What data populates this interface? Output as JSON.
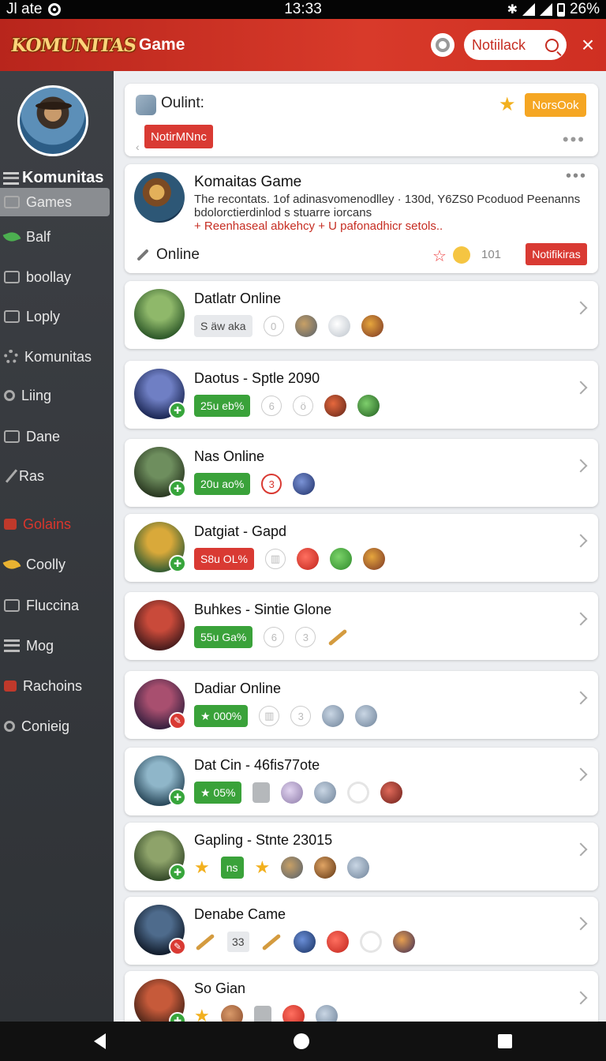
{
  "status": {
    "left": "Jl ate",
    "time": "13:33",
    "battery": "26%"
  },
  "header": {
    "logo": "KOMUNITAS",
    "game_label": "Game",
    "search_placeholder": "Notiilack",
    "close": "×"
  },
  "sidebar": {
    "title": "Komunitas",
    "items": [
      {
        "label": "Games",
        "icon": "games-icon",
        "active": true
      },
      {
        "label": "Balf",
        "icon": "leaf-icon"
      },
      {
        "label": "boollay",
        "icon": "box-icon"
      },
      {
        "label": "Loply",
        "icon": "grid-icon"
      },
      {
        "label": "Komunitas",
        "icon": "gear-icon"
      },
      {
        "label": "Liing",
        "icon": "search-icon"
      },
      {
        "label": "Dane",
        "icon": "box-icon"
      },
      {
        "label": "Ras",
        "icon": "wand-icon"
      },
      {
        "label": "Golains",
        "icon": "bag-icon",
        "red": true
      },
      {
        "label": "Coolly",
        "icon": "leaf-gold-icon"
      },
      {
        "label": "Fluccina",
        "icon": "grid-icon"
      },
      {
        "label": "Mog",
        "icon": "lines-icon"
      },
      {
        "label": "Rachoins",
        "icon": "bag-icon"
      },
      {
        "label": "Conieig",
        "icon": "user-icon"
      }
    ]
  },
  "top_card": {
    "title": "Oulint:",
    "badge": "NorsOok",
    "red_label": "NotirMNnc",
    "dot": "‹"
  },
  "featured": {
    "title": "Komaitas Game",
    "desc": "The recontats. 1of adinasvomenodlley · 130d, Y6ZS0 Pcoduod Peenanns bdolorctierdinlod s stuarre iorcans",
    "link": "+ Reenhaseal abkehcy + U pafonadhicr setols..",
    "online": "Online",
    "count": "101",
    "button": "Notifikiras"
  },
  "games": [
    {
      "title": "Datlatr Online",
      "pill": "S äw aka",
      "pill_style": "grey",
      "badge": "",
      "av_colors": [
        "#8fb86a",
        "#2f5a2a"
      ],
      "extras": [
        "0",
        "i1",
        "i2",
        "i3"
      ]
    },
    {
      "title": "Daotus - Sptle 2090",
      "pill": "25u eb%",
      "pill_style": "green",
      "badge": "green",
      "av_colors": [
        "#6f7fc4",
        "#1e2a58"
      ],
      "extras": [
        "6",
        "ö",
        "i4",
        "i5"
      ]
    },
    {
      "title": "Nas Online",
      "pill": "20u ao%",
      "pill_style": "green",
      "badge": "green",
      "av_colors": [
        "#6e8e5e",
        "#2b3a22"
      ],
      "extras": [
        "3r",
        "i6"
      ]
    },
    {
      "title": "Datgiat - Gapd",
      "pill": "S8u OL%",
      "pill_style": "red",
      "badge": "green",
      "av_colors": [
        "#d9a93a",
        "#3a5f33"
      ],
      "extras": [
        "bin",
        "i7",
        "i8",
        "i3"
      ]
    },
    {
      "title": "Buhkes - Sintie Glone",
      "pill": "55u Ga%",
      "pill_style": "green",
      "badge": "",
      "av_colors": [
        "#c94a3a",
        "#4a1d1d"
      ],
      "extras": [
        "6",
        "3",
        "stick"
      ]
    },
    {
      "title": "Dadiar Online",
      "pill": "★ 000%",
      "pill_style": "green",
      "badge": "red",
      "av_colors": [
        "#a84f6f",
        "#3a2140"
      ],
      "extras": [
        "bin",
        "3",
        "i9",
        "i9"
      ]
    },
    {
      "title": "Dat Cin - 46fis77ote",
      "pill": "★ 05%",
      "pill_style": "green",
      "badge": "green",
      "av_colors": [
        "#8fb6c9",
        "#2b4a5c"
      ],
      "extras": [
        "sq",
        "i10",
        "i9",
        "dot",
        "i11"
      ]
    },
    {
      "title": "Gapling - Stnte 23015",
      "pill": "ns",
      "pill_style": "square",
      "badge": "green",
      "av_colors": [
        "#8ea36a",
        "#364b2a"
      ],
      "extras": [
        "stary",
        "i1",
        "i12",
        "i9"
      ],
      "lead_star": true
    },
    {
      "title": "Denabe Came",
      "pill": "33",
      "pill_style": "num",
      "badge": "red",
      "av_colors": [
        "#4e6b8c",
        "#131e2e"
      ],
      "extras": [
        "stick2",
        "i5b",
        "i7",
        "dot",
        "i13"
      ],
      "lead_stick": true
    },
    {
      "title": "So Gian",
      "pill": "",
      "pill_style": "none",
      "badge": "green",
      "av_colors": [
        "#c65a3a",
        "#4a2418"
      ],
      "extras": [
        "stary",
        "brick",
        "sq",
        "i7",
        "i9"
      ]
    }
  ]
}
